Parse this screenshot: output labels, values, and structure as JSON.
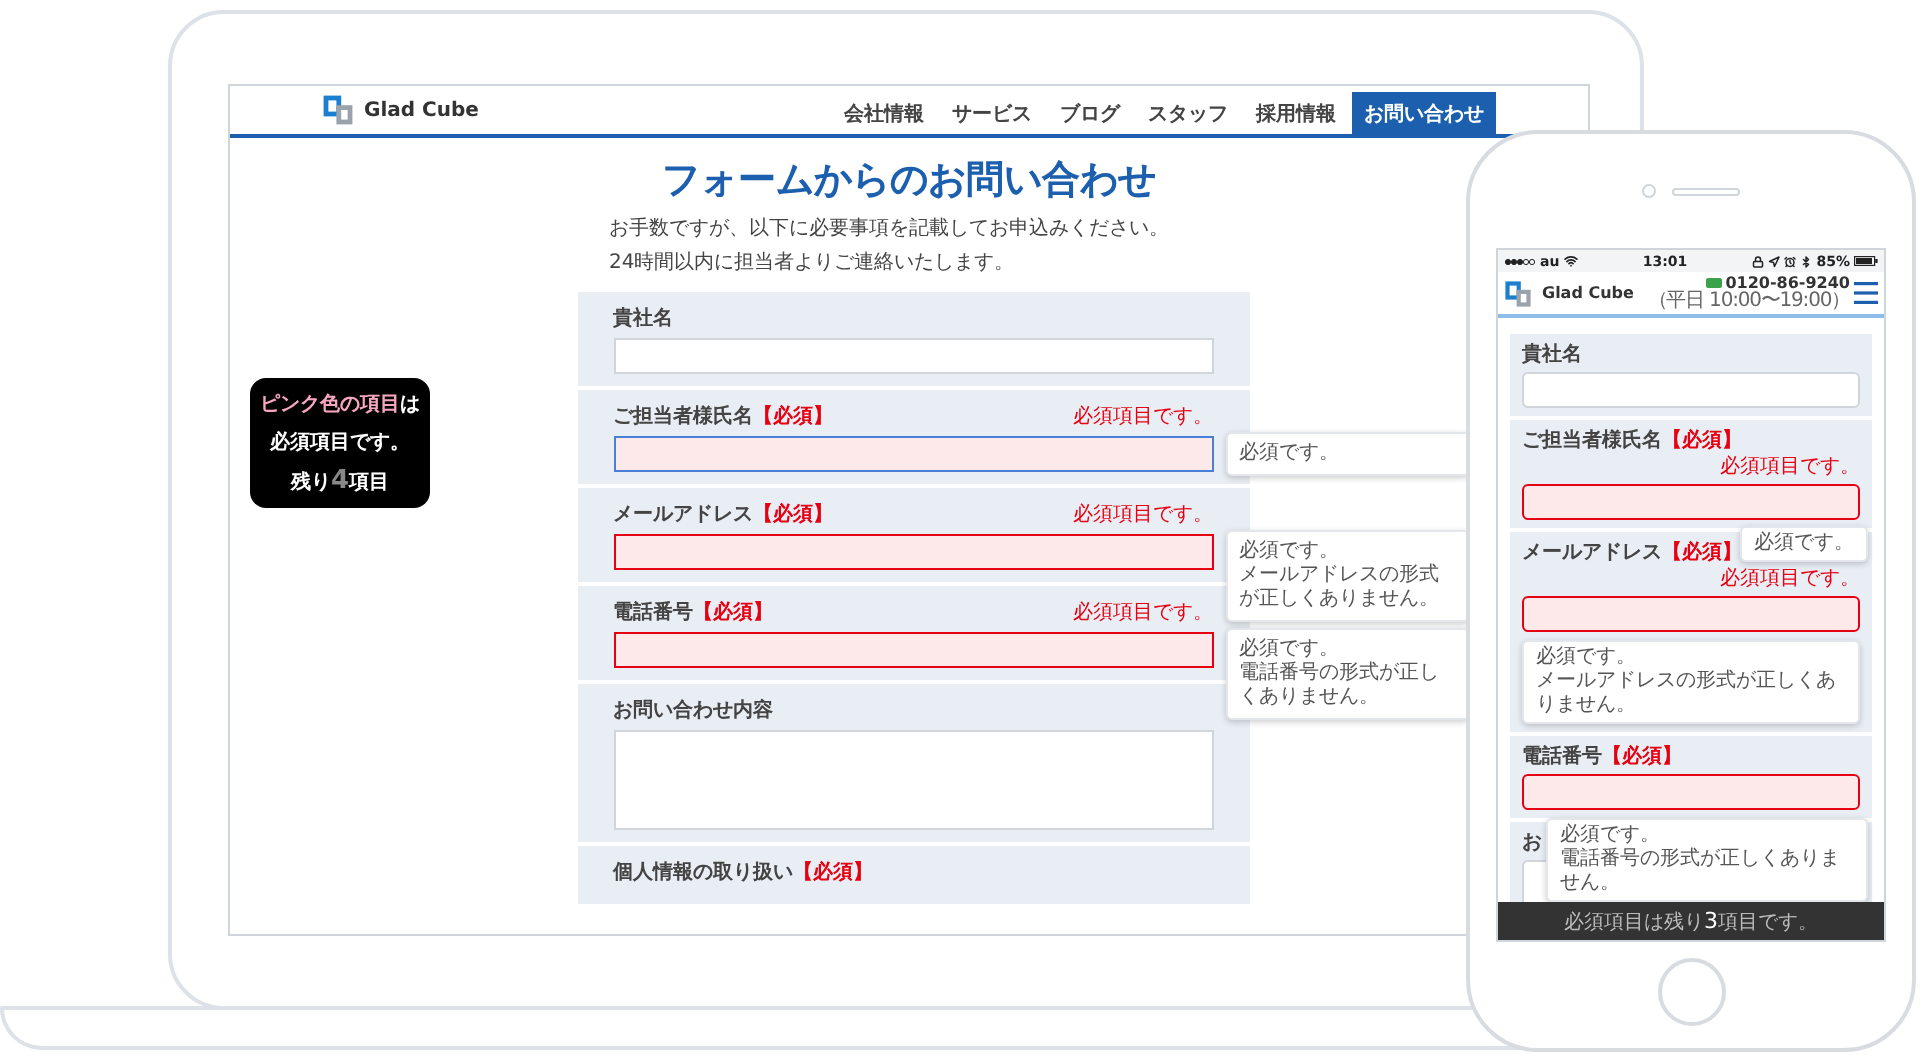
{
  "laptop": {
    "header": {
      "logo": "Glad Cube",
      "nav": [
        {
          "label": "会社情報",
          "selected": false
        },
        {
          "label": "サービス",
          "selected": false
        },
        {
          "label": "ブログ",
          "selected": false
        },
        {
          "label": "スタッフ",
          "selected": false
        },
        {
          "label": "採用情報",
          "selected": false
        },
        {
          "label": "お問い合わせ",
          "selected": true
        }
      ]
    },
    "title": "フォームからのお問い合わせ",
    "intro": [
      "お手数ですが、以下に必要事項を記載してお申込みください。",
      "24時間以内に担当者よりご連絡いたします。"
    ],
    "notice": [
      [
        {
          "text": "ピンク色の項目",
          "kind": "pink"
        },
        {
          "text": "は",
          "kind": "plain"
        }
      ],
      [
        {
          "text": "必須項目です。",
          "kind": "plain"
        }
      ],
      [
        {
          "text": "残り",
          "kind": "plain"
        },
        {
          "text": "4",
          "kind": "count"
        },
        {
          "text": "項目",
          "kind": "plain"
        }
      ]
    ],
    "fields": [
      {
        "label": "貴社名",
        "kind": "input",
        "invalid": false,
        "focused": false
      },
      {
        "label": "ご担当者様氏名",
        "mark": "【必須】",
        "error": "必須項目です。",
        "kind": "input",
        "invalid": true,
        "focused": true,
        "tooltip": [
          "必須です。"
        ]
      },
      {
        "label": "メールアドレス",
        "mark": "【必須】",
        "error": "必須項目です。",
        "kind": "input",
        "invalid": true,
        "focused": false,
        "tooltip": [
          "必須です。",
          "メールアドレスの形式が正しくありません。"
        ]
      },
      {
        "label": "電話番号",
        "mark": "【必須】",
        "error": "必須項目です。",
        "kind": "input",
        "invalid": true,
        "focused": false,
        "tooltip": [
          "必須です。",
          "電話番号の形式が正しくありません。"
        ]
      },
      {
        "label": "お問い合わせ内容",
        "kind": "textarea",
        "invalid": false,
        "focused": false
      },
      {
        "label": "個人情報の取り扱い",
        "mark": "【必須】",
        "kind": "label"
      }
    ]
  },
  "phone": {
    "status": {
      "carrier": "au",
      "time": "13:01",
      "battery": "85%"
    },
    "header": {
      "logo": "Glad Cube",
      "tel": "0120-86-9240",
      "hours": "（平日 10:00〜19:00）"
    },
    "fields": [
      {
        "label": "貴社名",
        "kind": "input",
        "invalid": false,
        "focused": false
      },
      {
        "label": "ご担当者様氏名",
        "mark": "【必須】",
        "error": "必須項目です。",
        "kind": "input",
        "invalid": true,
        "focused": false,
        "tooltip": [
          "必須です。"
        ]
      },
      {
        "label": "メールアドレス",
        "mark": "【必須】",
        "error": "必須項目です。",
        "kind": "input",
        "invalid": true,
        "focused": false,
        "tooltip": [
          "必須です。",
          "メールアドレスの形式が正しくありません。"
        ]
      },
      {
        "label": "電話番号",
        "mark": "【必須】",
        "kind": "input",
        "invalid": true,
        "focused": false,
        "tooltip": [
          "必須です。",
          "電話番号の形式が正しくありません。"
        ]
      },
      {
        "label": "お",
        "kind": "textarea",
        "invalid": false,
        "focused": false
      }
    ],
    "footer": [
      {
        "text": "必須項目は残り",
        "kind": "plain"
      },
      {
        "text": "3",
        "kind": "count"
      },
      {
        "text": "項目です。",
        "kind": "plain"
      }
    ]
  }
}
